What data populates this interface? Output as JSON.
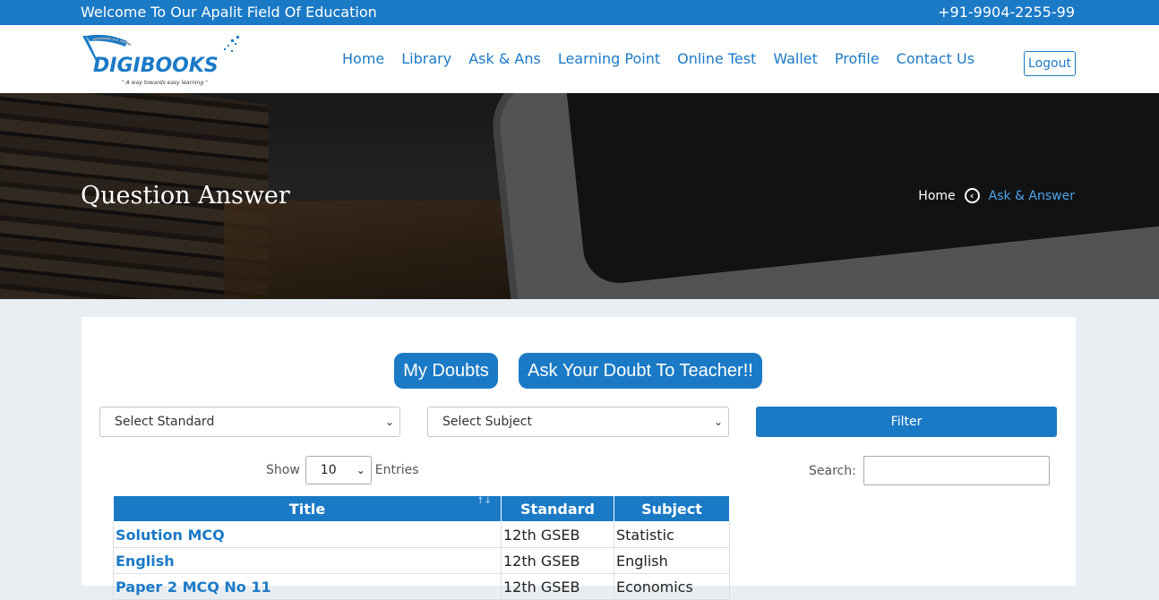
{
  "topbar": {
    "welcome": "Welcome To Our Apalit Field Of Education",
    "phone": "+91-9904-2255-99"
  },
  "brand": {
    "logo_text": "DIGIBOOKS",
    "tagline": "\" A way towards easy learning \""
  },
  "nav": {
    "items": [
      "Home",
      "Library",
      "Ask & Ans",
      "Learning Point",
      "Online Test",
      "Wallet",
      "Profile",
      "Contact Us"
    ],
    "logout_label": "Logout"
  },
  "hero": {
    "title": "Question Answer",
    "breadcrumb_home": "Home",
    "breadcrumb_current": "Ask & Answer"
  },
  "actions": {
    "my_doubts": "My Doubts",
    "ask_teacher": "Ask Your Doubt To Teacher!!"
  },
  "filters": {
    "standard_placeholder": "Select Standard",
    "subject_placeholder": "Select Subject",
    "filter_label": "Filter"
  },
  "table_controls": {
    "show_label": "Show",
    "entries_value": "10",
    "entries_label": "Entries",
    "search_label": "Search:"
  },
  "table": {
    "columns": [
      "Title",
      "Standard",
      "Subject"
    ],
    "rows": [
      [
        "Solution MCQ",
        "12th GSEB",
        "Statistic"
      ],
      [
        "English",
        "12th GSEB",
        "English"
      ],
      [
        "Paper 2 MCQ No 11",
        "12th GSEB",
        "Economics"
      ]
    ]
  },
  "colors": {
    "primary": "#1b7ac6",
    "link_light": "#4da3ea",
    "page_bg": "#e9eef2"
  }
}
